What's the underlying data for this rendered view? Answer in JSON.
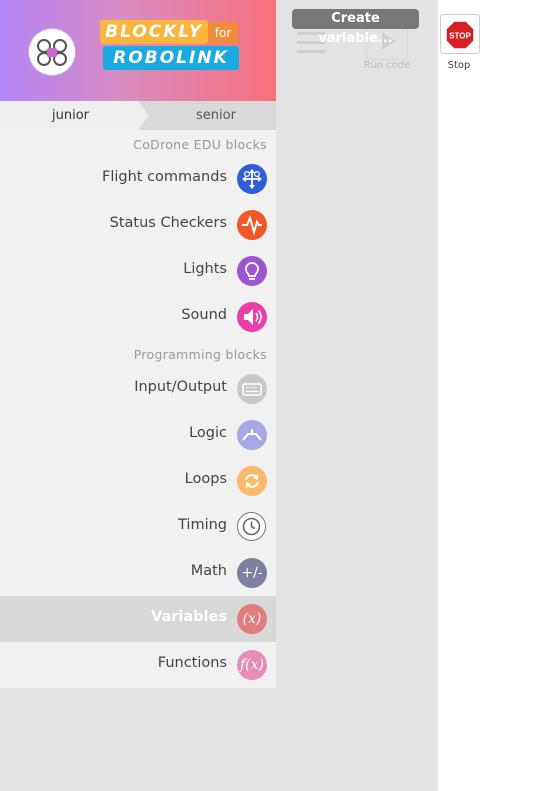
{
  "header": {
    "logo_top": "BLOCKLY",
    "logo_for": "for",
    "logo_bottom": "ROBOLINK"
  },
  "tabs": [
    {
      "label": "junior"
    },
    {
      "label": "senior"
    }
  ],
  "sections": [
    {
      "label": "CoDrone EDU blocks"
    },
    {
      "label": "Programming blocks"
    }
  ],
  "categories": [
    {
      "label": "Flight commands",
      "icon": "drone-arrows-icon",
      "color": "#2f5fd6"
    },
    {
      "label": "Status Checkers",
      "icon": "pulse-icon",
      "color": "#f0582a"
    },
    {
      "label": "Lights",
      "icon": "lightbulb-icon",
      "color": "#9b55cf"
    },
    {
      "label": "Sound",
      "icon": "speaker-icon",
      "color": "#ea3fa9"
    },
    {
      "label": "Input/Output",
      "icon": "keyboard-icon",
      "color": "#c8c8c8"
    },
    {
      "label": "Logic",
      "icon": "logic-icon",
      "color": "#a6a8e3"
    },
    {
      "label": "Loops",
      "icon": "loop-icon",
      "color": "#fbb969"
    },
    {
      "label": "Timing",
      "icon": "clock-icon",
      "color": "#ffffff"
    },
    {
      "label": "Math",
      "icon": "plus-minus-icon",
      "color": "#7d809f",
      "glyph": "+/-"
    },
    {
      "label": "Variables",
      "icon": "variable-icon",
      "color": "#e27d7f",
      "glyph": "(x)",
      "selected": true
    },
    {
      "label": "Functions",
      "icon": "function-icon",
      "color": "#e58db5",
      "glyph": "f(x)"
    }
  ],
  "flyout": {
    "create_variable": "Create variable..."
  },
  "toolbar": {
    "run_label": "Run code",
    "stop_label": "Stop",
    "stop_sign_text": "STOP"
  }
}
